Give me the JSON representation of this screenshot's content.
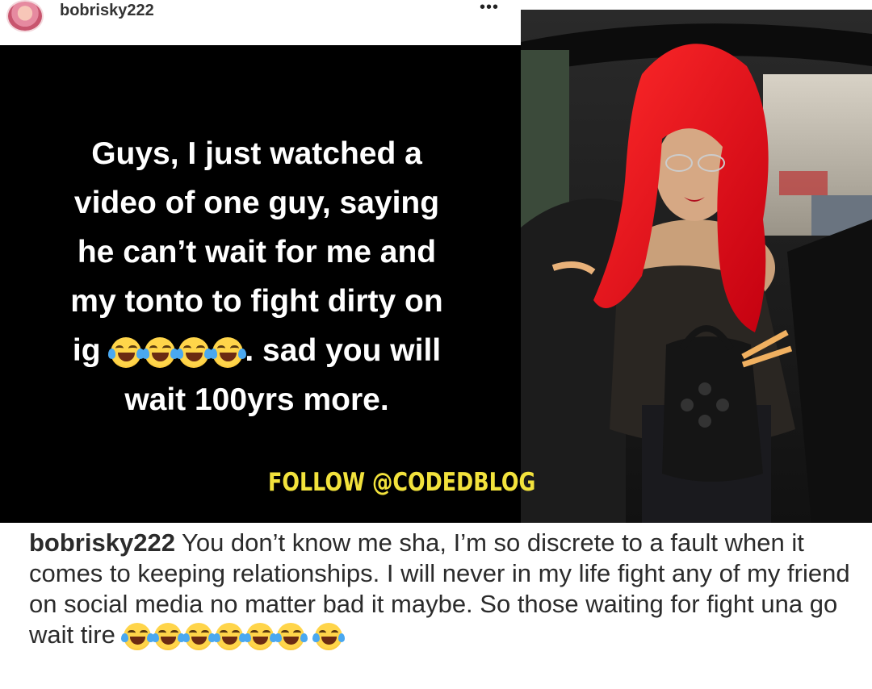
{
  "header": {
    "username": "bobrisky222",
    "more_label": "•••"
  },
  "post": {
    "quote_line1": "Guys, I just watched a",
    "quote_line2": "video of one guy, saying",
    "quote_line3": "he can’t wait for me and",
    "quote_line4": "my tonto to fight dirty on",
    "quote_line5_start": "ig",
    "quote_line5_end": ". sad you will",
    "quote_line6": "wait 100yrs more.",
    "watermark": "FOLLOW @CODEDBLOG"
  },
  "caption": {
    "username": "bobrisky222",
    "text": "You don’t know me sha, I’m so discrete to a fault when it comes to keeping relationships. I will never in my life fight any of my friend on social media no matter bad it maybe. So those waiting for fight una go wait tire"
  },
  "icons": {
    "emoji": "face-with-tears-of-joy",
    "more": "ellipsis-icon"
  }
}
